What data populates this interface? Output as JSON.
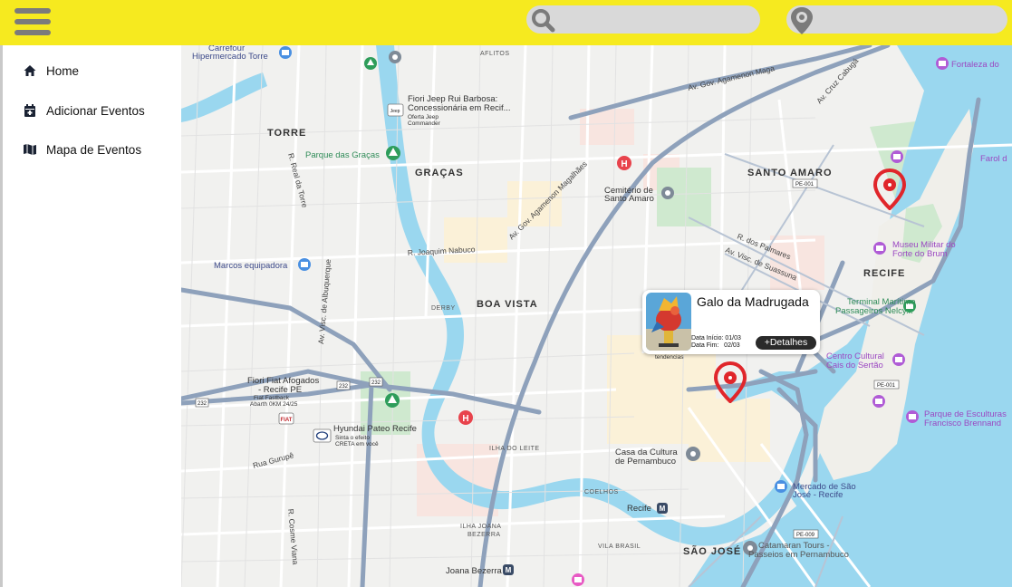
{
  "header": {
    "menu_icon": "hamburger-menu-icon",
    "search": {
      "icon": "search-icon",
      "placeholder": "",
      "value": ""
    },
    "location": {
      "icon": "location-pin-icon",
      "placeholder": "",
      "value": ""
    },
    "colors": {
      "background": "#f6ea1f",
      "field": "#d9d9d9",
      "icon": "#7b7b7b"
    }
  },
  "sidebar": {
    "items": [
      {
        "label": "Home",
        "icon": "home-icon"
      },
      {
        "label": "Adicionar Eventos",
        "icon": "calendar-icon"
      },
      {
        "label": "Mapa de Eventos",
        "icon": "map-icon"
      }
    ]
  },
  "map": {
    "labels": {
      "carrefour": "Carrefour",
      "hipermercado": "Hipermercado Torre",
      "aflitos": "AFLITOS",
      "agamenon_top": "Av. Gov. Agamenon Maga",
      "fortaleza": "Fortaleza do",
      "fiori_jeep_1": "Fiori Jeep Rui Barbosa:",
      "fiori_jeep_2": "Concessionária em Recif...",
      "oferta_jeep": "Oferta Jeep",
      "commander": "Commander",
      "torre": "TORRE",
      "parque_gracas": "Parque das Graças",
      "gracas": "GRAÇAS",
      "santo_amaro": "SANTO AMARO",
      "farol": "Farol d",
      "cemiterio_1": "Cemitério de",
      "cemiterio_2": "Santo Amaro",
      "museu_1": "Museu Militar do",
      "museu_2": "Forte do Brum",
      "recife_bairro": "RECIFE",
      "marcos": "Marcos equipadora",
      "joaquim_nabuco": "R. Joaquim Nabuco",
      "boa_vista": "BOA VISTA",
      "derby": "DERBY",
      "terminal_1": "Terminal Marítimo",
      "terminal_2": "Passageiros Nelcy...",
      "centro_1": "Centro Cultural",
      "centro_2": "Cais do Sertão",
      "tendencias": "tendencias",
      "fiori_fiat_1": "Fiori Fiat Afogados",
      "fiori_fiat_2": "- Recife PE",
      "fiat_fastback_1": "Fiat Fastback",
      "fiat_fastback_2": "Abarth 0KM 24/25",
      "hyundai": "Hyundai Pateo Recife",
      "creta_1": "Sinta o efeito",
      "creta_2": "CRETA em você",
      "ilha_leite": "ILHA DO LEITE",
      "casa_cultura_1": "Casa da Cultura",
      "casa_cultura_2": "de Pernambuco",
      "parque_esc_1": "Parque de Esculturas",
      "parque_esc_2": "Francisco Brennand",
      "mercado_1": "Mercado de São",
      "mercado_2": "José - Recife",
      "coelhos": "COELHOS",
      "recife_metro": "Recife",
      "ilha_joana_1": "ILHA JOANA",
      "ilha_joana_2": "BEZERRA",
      "vila_brasil": "VILA BRASIL",
      "sao_jose": "SÃO JOSÉ",
      "catamaran_1": "Catamaran Tours -",
      "catamaran_2": "Passeios em Pernambuco",
      "joana_bezerra": "Joana Bezerra",
      "agamenon_diag": "Av. Gov. Agamenon Magalhães",
      "visc_suassuna": "Av. Visc. de Suassuna",
      "cruz_cabuga": "Av. Cruz Cabugá",
      "dos_palmares": "R. dos Palmares",
      "real_torre": "R. Real da Torre",
      "visc_albuquerque": "Av. Visc. de Albuquerque",
      "rua_gurupe": "Rua Gurupê",
      "cosme_viana": "R. Cosme Viana",
      "pe001": "PE-001",
      "pe009": "PE-009",
      "br232": "232"
    }
  },
  "event_popup": {
    "title": "Galo da Madrugada",
    "start_date": "Data Início: 01/03",
    "end_date": "Data Fim:   02/03",
    "details_button": "+Detalhes"
  },
  "markers": [
    {
      "name": "event-marker-galo",
      "icon": "event-pin-icon",
      "color": "#e0262b"
    },
    {
      "name": "event-marker-recife-antigo",
      "icon": "event-pin-icon",
      "color": "#e0262b"
    }
  ]
}
